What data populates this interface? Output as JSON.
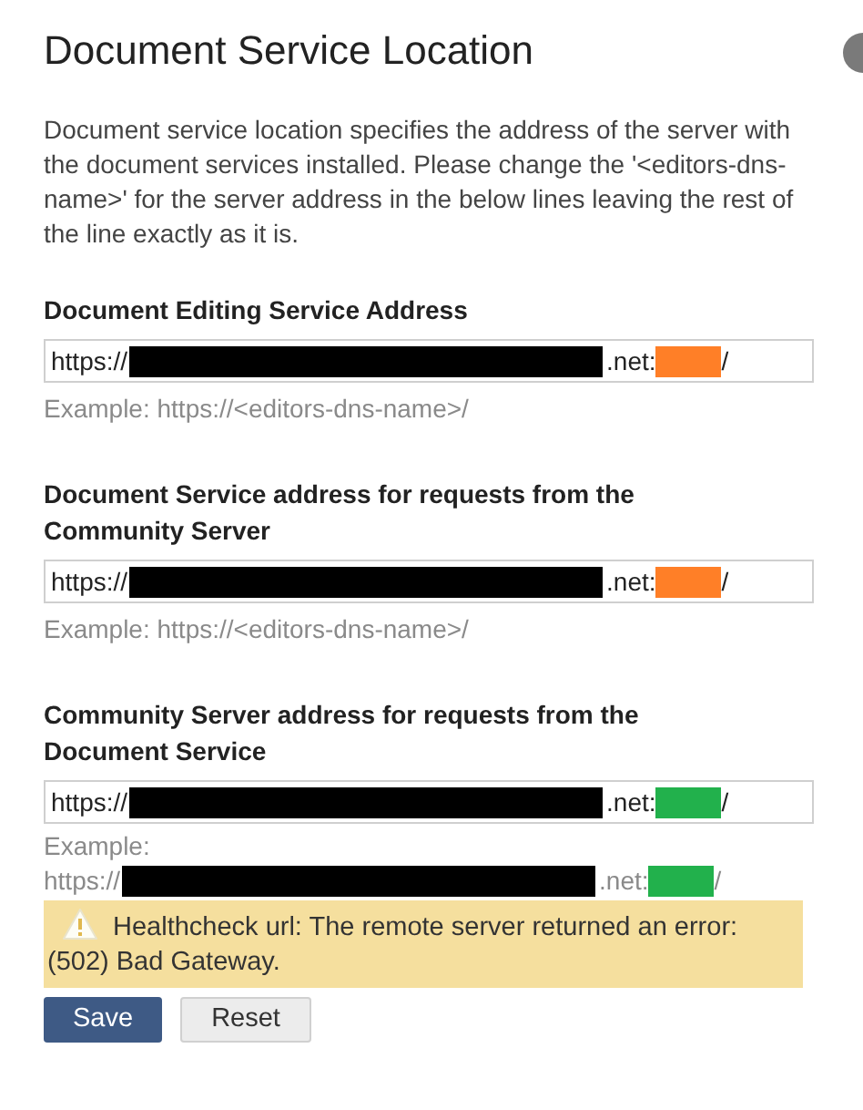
{
  "title": "Document Service Location",
  "description": "Document service location specifies the address of the server with the document services installed. Please change the '<editors-dns-name>' for the server address in the below lines leaving the rest of the line exactly as it is.",
  "sections": [
    {
      "label": "Document Editing Service Address",
      "field": {
        "prefix": "https://",
        "domain_end": ".net:",
        "end": "/",
        "color": "#ff7f27"
      },
      "example": {
        "kind": "text",
        "text": "Example: https://<editors-dns-name>/"
      }
    },
    {
      "label": "Document Service address for requests from the Community Server",
      "field": {
        "prefix": "https://",
        "domain_end": ".net:",
        "end": "/",
        "color": "#ff7f27"
      },
      "example": {
        "kind": "text",
        "text": "Example: https://<editors-dns-name>/"
      }
    },
    {
      "label": "Community Server address for requests from the Document Service",
      "field": {
        "prefix": "https://",
        "domain_end": ".net:",
        "end": "/",
        "color": "#22b14c"
      },
      "example": {
        "kind": "redacted",
        "label": "Example:",
        "prefix": "https://",
        "domain_end": ".net:",
        "end": "/",
        "color": "#22b14c"
      }
    }
  ],
  "warning": "Healthcheck url: The remote server returned an error: (502) Bad Gateway.",
  "buttons": [
    {
      "label": "Save",
      "kind": "primary"
    },
    {
      "label": "Reset",
      "kind": "secondary"
    }
  ]
}
